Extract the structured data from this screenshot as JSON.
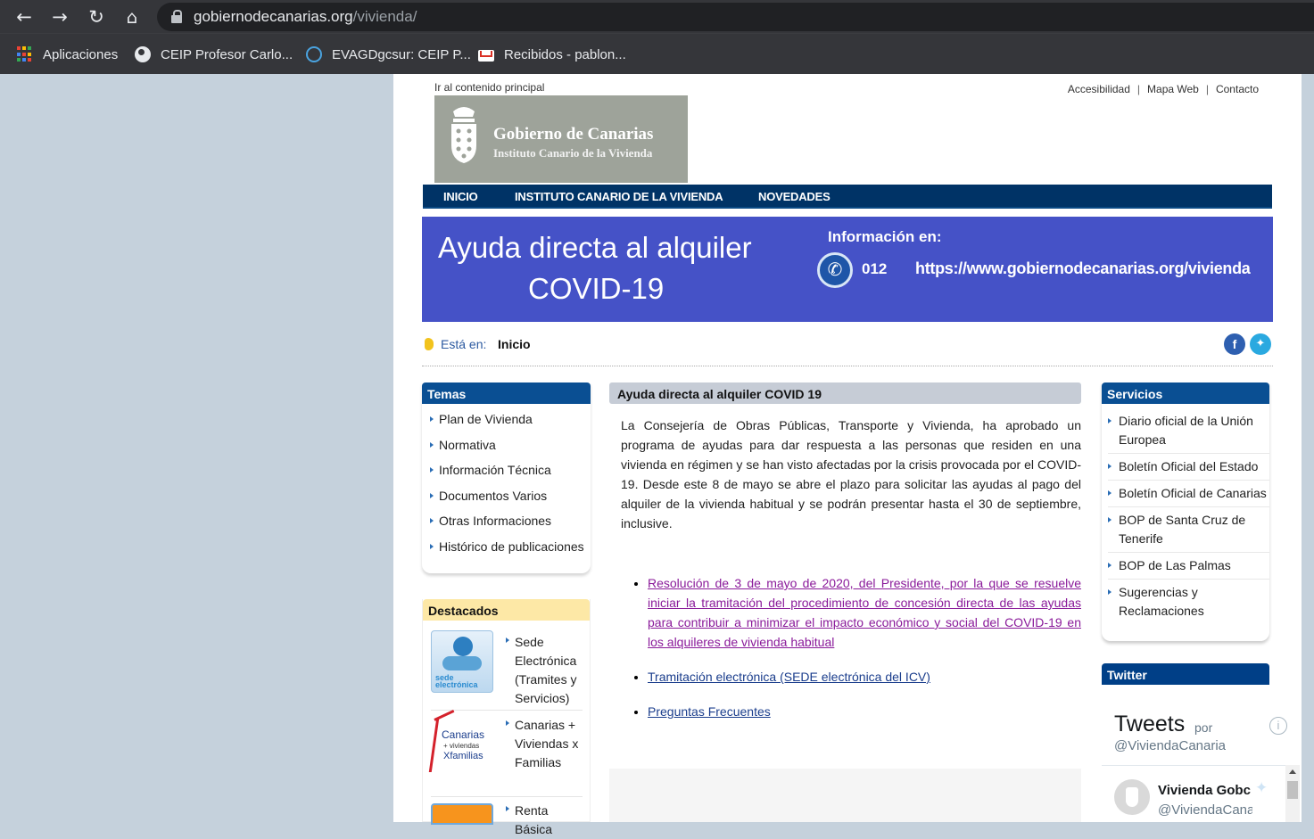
{
  "browser": {
    "url_host": "gobiernodecanarias.org",
    "url_path": "/vivienda/",
    "bookmarks": [
      {
        "label": "Aplicaciones",
        "icon": "apps-grid-icon"
      },
      {
        "label": "CEIP Profesor Carlo...",
        "icon": "globe-icon"
      },
      {
        "label": "EVAGDgcsur: CEIP P...",
        "icon": "moodle-circle-icon"
      },
      {
        "label": "Recibidos - pablon...",
        "icon": "gmail-icon"
      }
    ]
  },
  "header": {
    "skip_link": "Ir al contenido principal",
    "top_links": [
      "Accesibilidad",
      "Mapa Web",
      "Contacto"
    ],
    "logo_title": "Gobierno de Canarias",
    "logo_subtitle": "Instituto Canario de la Vivienda"
  },
  "menu": [
    "INICIO",
    "INSTITUTO CANARIO DE LA VIVIENDA",
    "NOVEDADES"
  ],
  "banner": {
    "title_line1": "Ayuda directa al alquiler",
    "title_line2": "COVID-19",
    "info_label": "Información en:",
    "phone": "012",
    "url": "https://www.gobiernodecanarias.org/vivienda",
    "bg_color": "#4552c7"
  },
  "breadcrumb": {
    "label": "Está en:",
    "current": "Inicio"
  },
  "temas": {
    "title": "Temas",
    "items": [
      "Plan de Vivienda",
      "Normativa",
      "Información Técnica",
      "Documentos Varios",
      "Otras Informaciones",
      "Histórico de publicaciones"
    ]
  },
  "destacados": {
    "title": "Destacados",
    "items": [
      {
        "lines": [
          "Sede",
          "Electrónica",
          "(Tramites y",
          "Servicios)"
        ],
        "img_text": "sede electrónica"
      },
      {
        "lines": [
          "Canarias +",
          "Viviendas x",
          "Familias"
        ],
        "img_lines": [
          "Canarias",
          "+ viviendas",
          "Xfamilias"
        ]
      },
      {
        "lines": [
          "Renta Básica"
        ]
      }
    ]
  },
  "main": {
    "title": "Ayuda directa al alquiler COVID 19",
    "paragraph": "La Consejería de Obras Públicas, Transporte y Vivienda, ha aprobado un programa de ayudas para dar respuesta a las personas que residen en una vivienda en régimen y se han visto afectadas por la crisis provocada por el COVID-19. Desde este 8 de mayo se abre el plazo para solicitar las ayudas al pago del alquiler de la vivienda habitual y se podrán presentar hasta el 30 de septiembre, inclusive.",
    "links": [
      "Resolución de 3 de mayo de 2020, del Presidente, por la que se resuelve iniciar la tramitación del procedimiento de concesión directa de las ayudas para contribuir a minimizar el impacto económico y social del COVID-19 en los alquileres de vivienda habitual",
      "Tramitación electrónica (SEDE electrónica del ICV)",
      "Preguntas Frecuentes"
    ]
  },
  "servicios": {
    "title": "Servicios",
    "items": [
      "Diario oficial de la Unión Europea",
      "Boletín Oficial del Estado",
      "Boletín Oficial de Canarias",
      "BOP de Santa Cruz de Tenerife",
      "BOP de Las Palmas",
      "Sugerencias y Reclamaciones"
    ]
  },
  "twitter": {
    "title": "Twitter",
    "tweets_label": "Tweets",
    "por": "por",
    "handle": "@ViviendaCanaria",
    "account_name": "Vivienda Gobc",
    "account_handle": "@ViviendaCana"
  },
  "colors": {
    "nav": "#003366",
    "temas_header": "#0a4f93",
    "twitter_header": "#003f87",
    "link_visited": "#8a1a9a"
  }
}
